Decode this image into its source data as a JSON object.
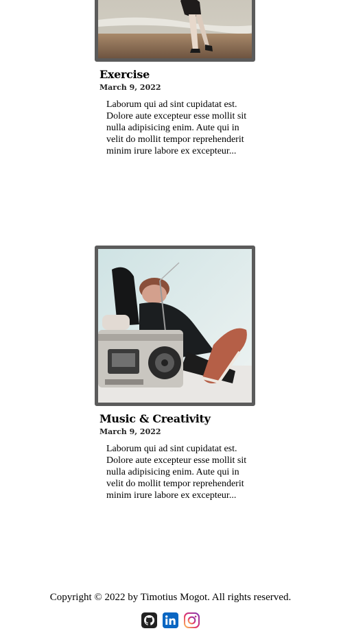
{
  "posts": [
    {
      "title": "Exercise",
      "date": "March 9, 2022",
      "excerpt": "Laborum qui ad sint cupidatat est. Dolore aute excepteur esse mollit sit nulla adipisicing enim. Aute qui in velit do mollit tempor reprehenderit minim irure labore ex excepteur...",
      "image": "woman-walking-on-beach-photo"
    },
    {
      "title": "Music & Creativity",
      "date": "March 9, 2022",
      "excerpt": "Laborum qui ad sint cupidatat est. Dolore aute excepteur esse mollit sit nulla adipisicing enim. Aute qui in velit do mollit tempor reprehenderit minim irure labore ex excepteur...",
      "image": "person-lying-with-boombox-photo"
    }
  ],
  "footer": {
    "copyright": "Copyright © 2022 by Timotius Mogot. All rights reserved.",
    "socials": [
      {
        "icon": "github-icon",
        "color": "#222222"
      },
      {
        "icon": "linkedin-icon",
        "color": "#0a66c2"
      },
      {
        "icon": "instagram-icon",
        "color": "#d6249f"
      }
    ]
  },
  "colors": {
    "frame_border": "#5b5b5b",
    "text": "#000000"
  }
}
